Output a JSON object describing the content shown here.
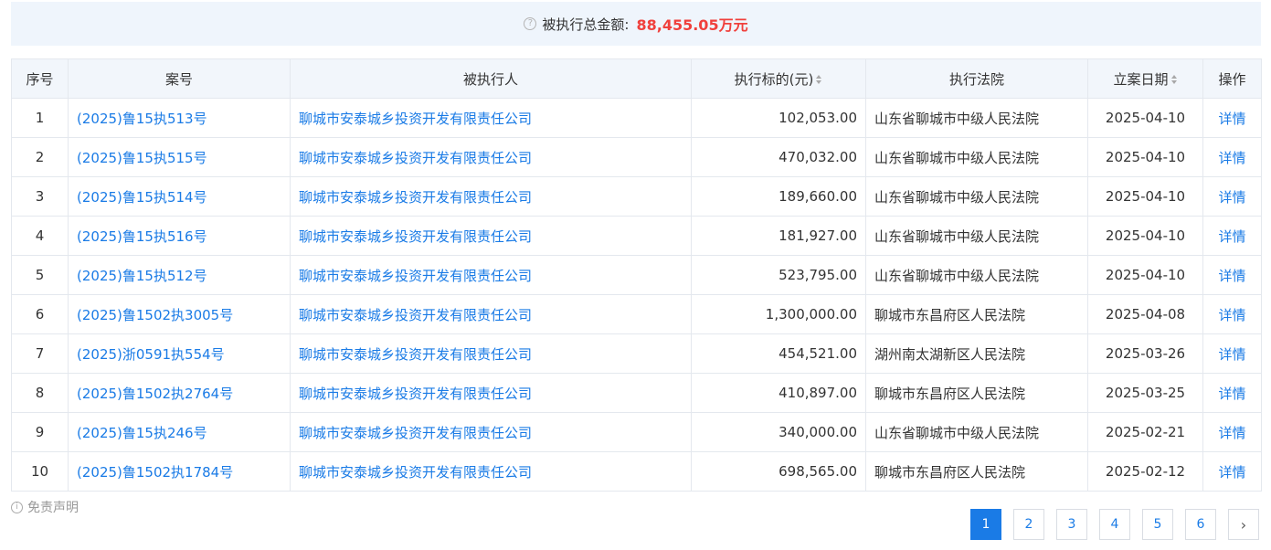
{
  "summary": {
    "help_icon": "question-circle-icon",
    "label": "被执行总金额:",
    "amount": "88,455.05万元",
    "amount_color": "#f0403c"
  },
  "table": {
    "headers": {
      "index": "序号",
      "case_no": "案号",
      "party": "被执行人",
      "amount": "执行标的(元)",
      "court": "执行法院",
      "date": "立案日期",
      "action": "操作"
    },
    "rows": [
      {
        "index": "1",
        "case_no": "(2025)鲁15执513号",
        "party": "聊城市安泰城乡投资开发有限责任公司",
        "amount": "102,053.00",
        "court": "山东省聊城市中级人民法院",
        "date": "2025-04-10",
        "action": "详情"
      },
      {
        "index": "2",
        "case_no": "(2025)鲁15执515号",
        "party": "聊城市安泰城乡投资开发有限责任公司",
        "amount": "470,032.00",
        "court": "山东省聊城市中级人民法院",
        "date": "2025-04-10",
        "action": "详情"
      },
      {
        "index": "3",
        "case_no": "(2025)鲁15执514号",
        "party": "聊城市安泰城乡投资开发有限责任公司",
        "amount": "189,660.00",
        "court": "山东省聊城市中级人民法院",
        "date": "2025-04-10",
        "action": "详情"
      },
      {
        "index": "4",
        "case_no": "(2025)鲁15执516号",
        "party": "聊城市安泰城乡投资开发有限责任公司",
        "amount": "181,927.00",
        "court": "山东省聊城市中级人民法院",
        "date": "2025-04-10",
        "action": "详情"
      },
      {
        "index": "5",
        "case_no": "(2025)鲁15执512号",
        "party": "聊城市安泰城乡投资开发有限责任公司",
        "amount": "523,795.00",
        "court": "山东省聊城市中级人民法院",
        "date": "2025-04-10",
        "action": "详情"
      },
      {
        "index": "6",
        "case_no": "(2025)鲁1502执3005号",
        "party": "聊城市安泰城乡投资开发有限责任公司",
        "amount": "1,300,000.00",
        "court": "聊城市东昌府区人民法院",
        "date": "2025-04-08",
        "action": "详情"
      },
      {
        "index": "7",
        "case_no": "(2025)浙0591执554号",
        "party": "聊城市安泰城乡投资开发有限责任公司",
        "amount": "454,521.00",
        "court": "湖州南太湖新区人民法院",
        "date": "2025-03-26",
        "action": "详情"
      },
      {
        "index": "8",
        "case_no": "(2025)鲁1502执2764号",
        "party": "聊城市安泰城乡投资开发有限责任公司",
        "amount": "410,897.00",
        "court": "聊城市东昌府区人民法院",
        "date": "2025-03-25",
        "action": "详情"
      },
      {
        "index": "9",
        "case_no": "(2025)鲁15执246号",
        "party": "聊城市安泰城乡投资开发有限责任公司",
        "amount": "340,000.00",
        "court": "山东省聊城市中级人民法院",
        "date": "2025-02-21",
        "action": "详情"
      },
      {
        "index": "10",
        "case_no": "(2025)鲁1502执1784号",
        "party": "聊城市安泰城乡投资开发有限责任公司",
        "amount": "698,565.00",
        "court": "聊城市东昌府区人民法院",
        "date": "2025-02-12",
        "action": "详情"
      }
    ]
  },
  "disclaimer": {
    "icon": "info-circle-icon",
    "label": "免责声明"
  },
  "pagination": {
    "pages": [
      "1",
      "2",
      "3",
      "4",
      "5",
      "6"
    ],
    "current": "1",
    "next_icon": "chevron-right-icon",
    "accent_color": "#1a7be6"
  }
}
